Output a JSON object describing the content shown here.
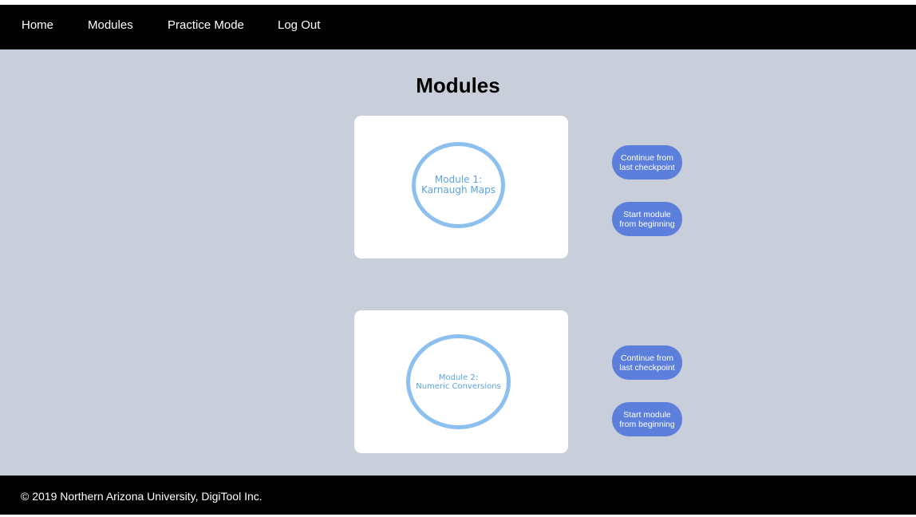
{
  "nav": {
    "items": [
      "Home",
      "Modules",
      "Practice Mode",
      "Log Out"
    ]
  },
  "main": {
    "title": "Modules",
    "modules": [
      {
        "circle_line1": "Module 1:",
        "circle_line2": "Karnaugh Maps",
        "continue_line1": "Continue from",
        "continue_line2": "last checkpoint",
        "start_line1": "Start module",
        "start_line2": "from beginning"
      },
      {
        "circle_line1": "Module 2:",
        "circle_line2": "Numeric Conversions",
        "continue_line1": "Continue from",
        "continue_line2": "last checkpoint",
        "start_line1": "Start module",
        "start_line2": "from beginning"
      }
    ]
  },
  "footer": {
    "text": "© 2019 Northern Arizona University, DigiTool Inc."
  },
  "colors": {
    "nav_bg": "#000000",
    "page_bg": "#c8cfda",
    "ring": "#8dc0ee",
    "ring_text": "#5aa2e0",
    "button_bg": "#5b7fdb"
  }
}
